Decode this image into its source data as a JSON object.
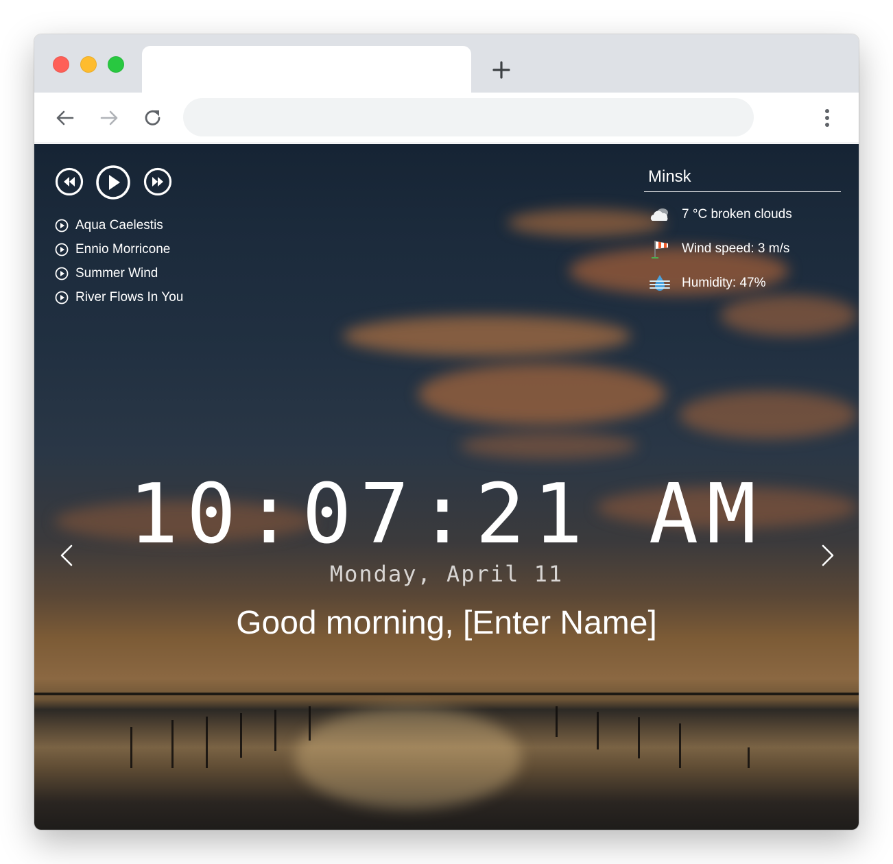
{
  "browser": {
    "tab_title": "",
    "url": "",
    "icons": {
      "new_tab": "plus-icon",
      "back": "arrow-left-icon",
      "forward": "arrow-right-icon",
      "reload": "reload-icon",
      "menu": "kebab-menu-icon"
    }
  },
  "player": {
    "controls": [
      "rewind-icon",
      "play-icon",
      "fast-forward-icon"
    ],
    "playlist": [
      {
        "title": "Aqua Caelestis"
      },
      {
        "title": "Ennio Morricone"
      },
      {
        "title": "Summer Wind"
      },
      {
        "title": "River Flows In You"
      }
    ]
  },
  "weather": {
    "city": "Minsk",
    "description": "7 °C broken clouds",
    "wind": "Wind speed: 3 m/s",
    "humidity": "Humidity: 47%",
    "icons": [
      "cloud-icon",
      "windsock-icon",
      "humidity-icon"
    ]
  },
  "clock": {
    "time": "10:07:21 AM",
    "date": "Monday, April 11"
  },
  "greeting": {
    "text": "Good morning, [Enter Name]"
  },
  "colors": {
    "close": "#fe5f57",
    "minimize": "#febc2e",
    "maximize": "#28c840",
    "tabbar": "#dee1e6",
    "text": "#ffffff"
  }
}
